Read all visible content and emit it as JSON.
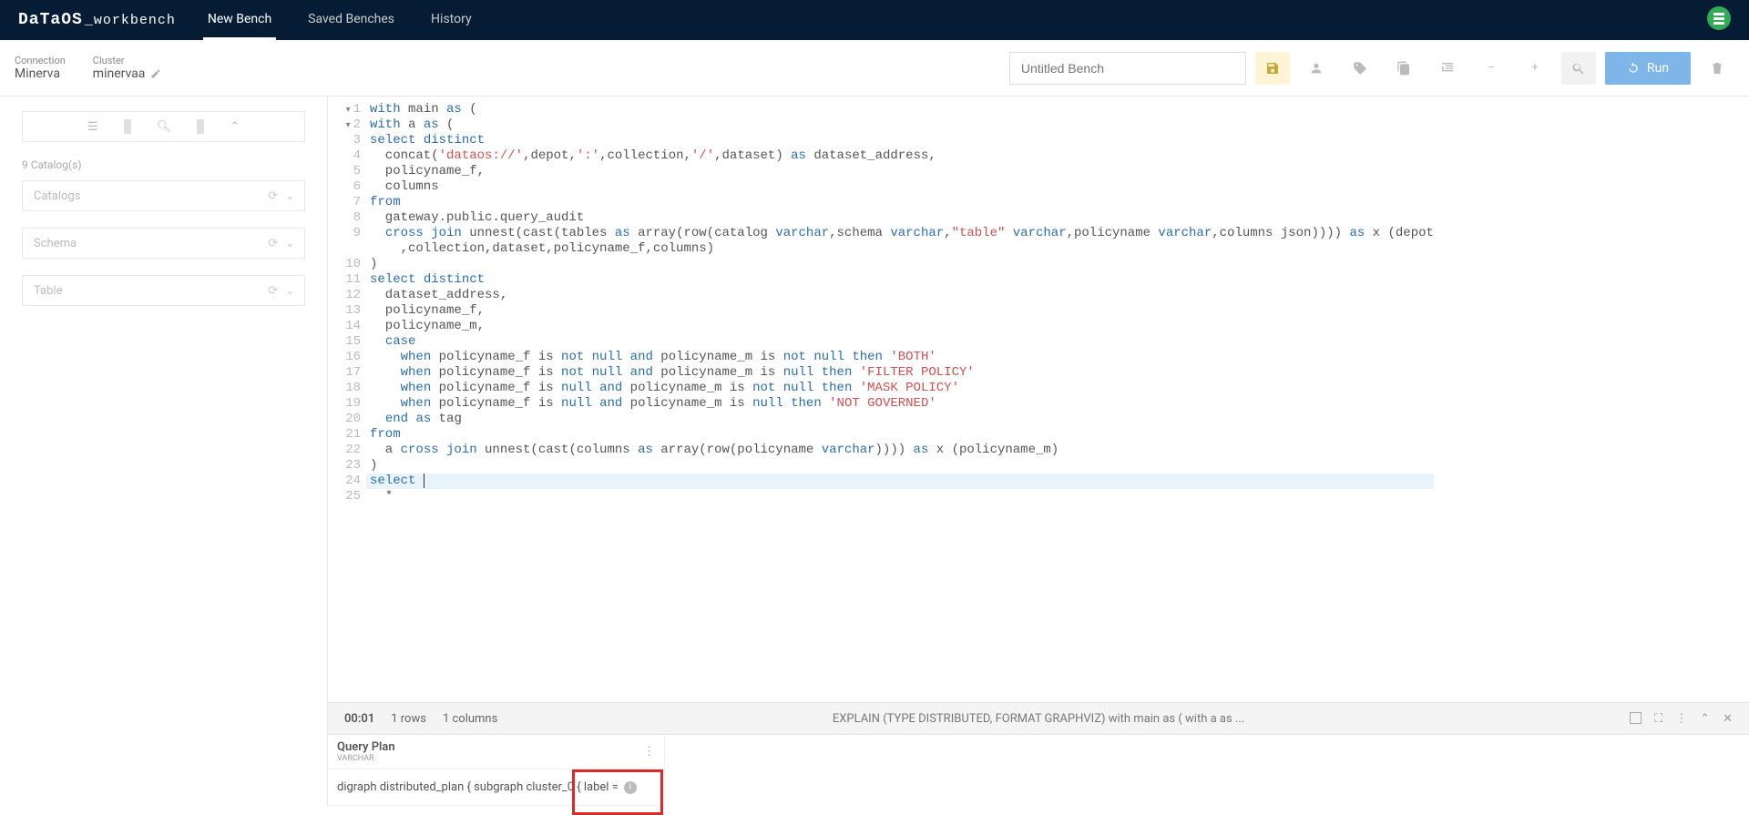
{
  "header": {
    "logo_main": "DaTaOS",
    "logo_sub": "_workbench",
    "tabs": [
      "New Bench",
      "Saved Benches",
      "History"
    ],
    "active_tab": 0
  },
  "subheader": {
    "connection_label": "Connection",
    "connection_value": "Minerva",
    "cluster_label": "Cluster",
    "cluster_value": "minervaa",
    "title_placeholder": "Untitled Bench",
    "run_label": "Run"
  },
  "sidebar": {
    "catalog_count": "9 Catalog(s)",
    "selects": [
      "Catalogs",
      "Schema",
      "Table"
    ]
  },
  "code": {
    "lines": [
      {
        "n": "1",
        "fold": "▾",
        "html": "<span class='kw'>with</span> main <span class='kw'>as</span> ("
      },
      {
        "n": "2",
        "fold": "▾",
        "html": "<span class='kw'>with</span> a <span class='kw'>as</span> ("
      },
      {
        "n": "3",
        "html": "<span class='kw'>select</span> <span class='kw'>distinct</span>"
      },
      {
        "n": "4",
        "html": "  concat(<span class='str'>'dataos://'</span>,depot,<span class='str'>':'</span>,collection,<span class='str'>'/'</span>,dataset) <span class='kw'>as</span> dataset_address,"
      },
      {
        "n": "5",
        "html": "  policyname_f,"
      },
      {
        "n": "6",
        "html": "  columns"
      },
      {
        "n": "7",
        "html": "<span class='kw'>from</span>"
      },
      {
        "n": "8",
        "html": "  gateway.public.query_audit"
      },
      {
        "n": "9",
        "html": "  <span class='kw'>cross join</span> unnest(cast(tables <span class='kw'>as</span> array(row(catalog <span class='kw'>varchar</span>,schema <span class='kw'>varchar</span>,<span class='str'>\"table\"</span> <span class='kw'>varchar</span>,policyname <span class='kw'>varchar</span>,columns json)))) <span class='kw'>as</span> x (depot<br>    ,collection,dataset,policyname_f,columns)"
      },
      {
        "n": "10",
        "html": ")"
      },
      {
        "n": "11",
        "html": "<span class='kw'>select</span> <span class='kw'>distinct</span>"
      },
      {
        "n": "12",
        "html": "  dataset_address,"
      },
      {
        "n": "13",
        "html": "  policyname_f,"
      },
      {
        "n": "14",
        "html": "  policyname_m,"
      },
      {
        "n": "15",
        "html": "  <span class='kw'>case</span>"
      },
      {
        "n": "16",
        "html": "    <span class='kw'>when</span> policyname_f is <span class='kw'>not null</span> <span class='kw'>and</span> policyname_m is <span class='kw'>not null</span> <span class='kw'>then</span> <span class='str'>'BOTH'</span>"
      },
      {
        "n": "17",
        "html": "    <span class='kw'>when</span> policyname_f is <span class='kw'>not null</span> <span class='kw'>and</span> policyname_m is <span class='kw'>null</span> <span class='kw'>then</span> <span class='str'>'FILTER POLICY'</span>"
      },
      {
        "n": "18",
        "html": "    <span class='kw'>when</span> policyname_f is <span class='kw'>null</span> <span class='kw'>and</span> policyname_m is <span class='kw'>not null</span> <span class='kw'>then</span> <span class='str'>'MASK POLICY'</span>"
      },
      {
        "n": "19",
        "html": "    <span class='kw'>when</span> policyname_f is <span class='kw'>null</span> <span class='kw'>and</span> policyname_m is <span class='kw'>null</span> <span class='kw'>then</span> <span class='str'>'NOT GOVERNED'</span>"
      },
      {
        "n": "20",
        "html": "  <span class='kw'>end</span> <span class='kw'>as</span> tag"
      },
      {
        "n": "21",
        "html": "<span class='kw'>from</span>"
      },
      {
        "n": "22",
        "html": "  a <span class='kw'>cross join</span> unnest(cast(columns <span class='kw'>as</span> array(row(policyname <span class='kw'>varchar</span>)))) <span class='kw'>as</span> x (policyname_m)"
      },
      {
        "n": "23",
        "html": ")"
      },
      {
        "n": "24",
        "hl": true,
        "html": "<span class='kw'>select</span> <span style='border-left:1px solid #333'>&nbsp;</span>"
      },
      {
        "n": "25",
        "html": "  *"
      }
    ]
  },
  "results": {
    "time": "00:01",
    "rows": "1 rows",
    "cols": "1 columns",
    "query_summary": "EXPLAIN (TYPE DISTRIBUTED, FORMAT GRAPHVIZ) with main as ( with a as ...",
    "column_title": "Query Plan",
    "column_type": "VARCHAR",
    "cell_value": "digraph distributed_plan { subgraph cluster_0 { label ="
  }
}
